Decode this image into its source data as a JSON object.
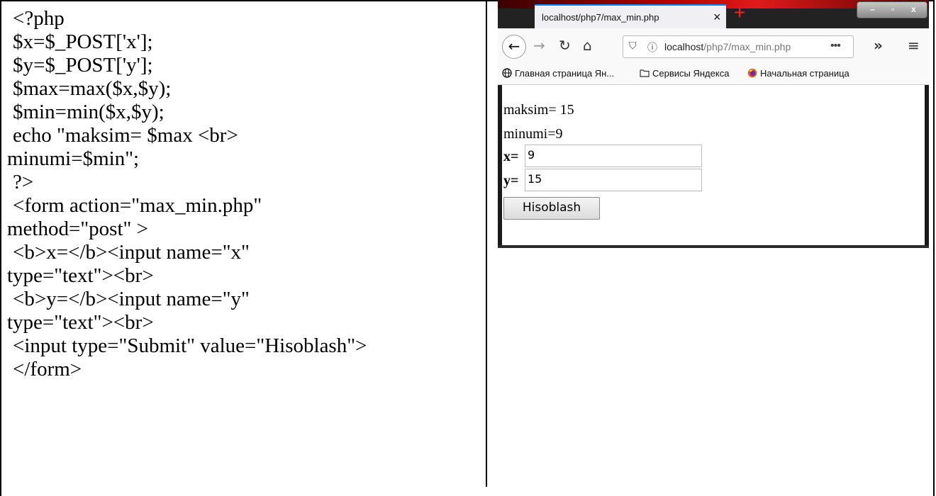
{
  "code_lines": [
    "<?php",
    "$x=$_POST['x'];",
    "$y=$_POST['y'];",
    "$max=max($x,$y);",
    "$min=min($x,$y);",
    "echo \"maksim= $max <br>",
    "minumi=$min\";",
    "?>",
    "<form action=\"max_min.php\"",
    "method=\"post\" >",
    "<b>x=</b><input name=\"x\"",
    "type=\"text\"><br>",
    "<b>y=</b><input name=\"y\"",
    "type=\"text\"><br>",
    "<input type=\"Submit\" value=\"Hisoblash\">",
    "</form>"
  ],
  "browser": {
    "tab_title": "localhost/php7/max_min.php",
    "tab_close": "×",
    "new_tab": "+",
    "url_host": "localhost",
    "url_path": "/php7/max_min.php",
    "url_more": "•••",
    "overflow": "»",
    "menu": "≡",
    "bookmarks": [
      {
        "label": "Главная страница Ян...",
        "icon": "globe-icon"
      },
      {
        "label": "Сервисы Яндекса",
        "icon": "folder-icon"
      },
      {
        "label": "Начальная страница",
        "icon": "firefox-icon"
      }
    ]
  },
  "page": {
    "max_line": "maksim= 15",
    "min_line": "minumi=9",
    "x_label": "x=",
    "x_value": "9",
    "y_label": "y=",
    "y_value": "15",
    "submit_label": "Hisoblash"
  },
  "colors": {
    "tab_accent": "#0a84ff",
    "new_tab_plus": "#ff2020"
  }
}
